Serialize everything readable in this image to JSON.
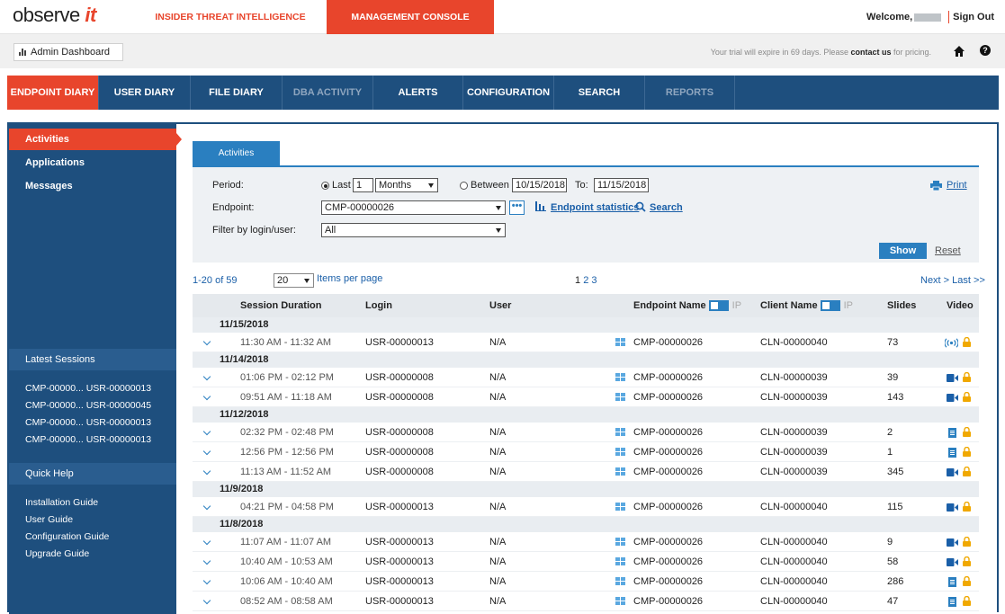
{
  "header": {
    "logo_main": "observe",
    "logo_accent": "it",
    "tab_insider": "INSIDER THREAT INTELLIGENCE",
    "tab_console": "MANAGEMENT CONSOLE",
    "welcome": "Welcome,",
    "signout": "Sign Out"
  },
  "subbar": {
    "admin_dashboard": "Admin Dashboard",
    "trial_prefix": "Your trial will expire in 69 days. Please ",
    "trial_link": "contact us",
    "trial_suffix": " for pricing."
  },
  "nav": [
    {
      "label": "ENDPOINT DIARY",
      "state": "active"
    },
    {
      "label": "USER DIARY",
      "state": "normal"
    },
    {
      "label": "FILE DIARY",
      "state": "normal"
    },
    {
      "label": "DBA ACTIVITY",
      "state": "disabled"
    },
    {
      "label": "ALERTS",
      "state": "normal"
    },
    {
      "label": "CONFIGURATION",
      "state": "normal"
    },
    {
      "label": "SEARCH",
      "state": "normal"
    },
    {
      "label": "REPORTS",
      "state": "disabled"
    }
  ],
  "sidebar": {
    "items": [
      "Activities",
      "Applications",
      "Messages"
    ],
    "latest_sessions_title": "Latest Sessions",
    "latest_sessions": [
      {
        "endpoint": "CMP-00000...",
        "user": "USR-00000013"
      },
      {
        "endpoint": "CMP-00000...",
        "user": "USR-00000045"
      },
      {
        "endpoint": "CMP-00000...",
        "user": "USR-00000013"
      },
      {
        "endpoint": "CMP-00000...",
        "user": "USR-00000013"
      }
    ],
    "quick_help_title": "Quick Help",
    "quick_help": [
      "Installation Guide",
      "User Guide",
      "Configuration Guide",
      "Upgrade Guide"
    ]
  },
  "panel": {
    "tab": "Activities",
    "period_label": "Period:",
    "last_label": "Last",
    "last_value": "1",
    "unit": "Months",
    "between_label": "Between",
    "from_date": "10/15/2018",
    "to_label": "To:",
    "to_date": "11/15/2018",
    "print": "Print",
    "endpoint_label": "Endpoint:",
    "endpoint_value": "CMP-00000026",
    "dots": "•••",
    "endpoint_stats": "Endpoint statistics",
    "search": "Search",
    "filter_label": "Filter by login/user:",
    "filter_value": "All",
    "show": "Show",
    "reset": "Reset"
  },
  "pager": {
    "range": "1-20 of 59",
    "per_page_value": "20",
    "per_page_label": "Items per page",
    "page1": "1",
    "page2": "2",
    "page3": "3",
    "next": "Next >",
    "last": "Last >>"
  },
  "table": {
    "headers": {
      "session_duration": "Session Duration",
      "login": "Login",
      "user": "User",
      "endpoint_name": "Endpoint Name",
      "client_name": "Client Name",
      "ip": "IP",
      "slides": "Slides",
      "video": "Video"
    },
    "groups": [
      {
        "date": "11/15/2018",
        "rows": [
          {
            "duration": "11:30 AM - 11:32 AM",
            "login": "USR-00000013",
            "user": "N/A",
            "endpoint": "CMP-00000026",
            "client": "CLN-00000040",
            "slides": "73",
            "video": "live-icon"
          }
        ]
      },
      {
        "date": "11/14/2018",
        "rows": [
          {
            "duration": "01:06 PM - 02:12 PM",
            "login": "USR-00000008",
            "user": "N/A",
            "endpoint": "CMP-00000026",
            "client": "CLN-00000039",
            "slides": "39",
            "video": "video-icon"
          },
          {
            "duration": "09:51 AM - 11:18 AM",
            "login": "USR-00000008",
            "user": "N/A",
            "endpoint": "CMP-00000026",
            "client": "CLN-00000039",
            "slides": "143",
            "video": "video-icon"
          }
        ]
      },
      {
        "date": "11/12/2018",
        "rows": [
          {
            "duration": "02:32 PM - 02:48 PM",
            "login": "USR-00000008",
            "user": "N/A",
            "endpoint": "CMP-00000026",
            "client": "CLN-00000039",
            "slides": "2",
            "video": "slides-icon"
          },
          {
            "duration": "12:56 PM - 12:56 PM",
            "login": "USR-00000008",
            "user": "N/A",
            "endpoint": "CMP-00000026",
            "client": "CLN-00000039",
            "slides": "1",
            "video": "slides-icon"
          },
          {
            "duration": "11:13 AM - 11:52 AM",
            "login": "USR-00000008",
            "user": "N/A",
            "endpoint": "CMP-00000026",
            "client": "CLN-00000039",
            "slides": "345",
            "video": "video-icon"
          }
        ]
      },
      {
        "date": "11/9/2018",
        "rows": [
          {
            "duration": "04:21 PM - 04:58 PM",
            "login": "USR-00000013",
            "user": "N/A",
            "endpoint": "CMP-00000026",
            "client": "CLN-00000040",
            "slides": "115",
            "video": "video-icon"
          }
        ]
      },
      {
        "date": "11/8/2018",
        "rows": [
          {
            "duration": "11:07 AM - 11:07 AM",
            "login": "USR-00000013",
            "user": "N/A",
            "endpoint": "CMP-00000026",
            "client": "CLN-00000040",
            "slides": "9",
            "video": "video-icon"
          },
          {
            "duration": "10:40 AM - 10:53 AM",
            "login": "USR-00000013",
            "user": "N/A",
            "endpoint": "CMP-00000026",
            "client": "CLN-00000040",
            "slides": "58",
            "video": "video-icon"
          },
          {
            "duration": "10:06 AM - 10:40 AM",
            "login": "USR-00000013",
            "user": "N/A",
            "endpoint": "CMP-00000026",
            "client": "CLN-00000040",
            "slides": "286",
            "video": "slides-icon"
          },
          {
            "duration": "08:52 AM - 08:58 AM",
            "login": "USR-00000013",
            "user": "N/A",
            "endpoint": "CMP-00000026",
            "client": "CLN-00000040",
            "slides": "47",
            "video": "slides-icon"
          }
        ]
      }
    ]
  },
  "colors": {
    "accent": "#e8452c",
    "navy": "#1e4f7e",
    "blue": "#2a7fc0",
    "lock": "#f0a800"
  }
}
